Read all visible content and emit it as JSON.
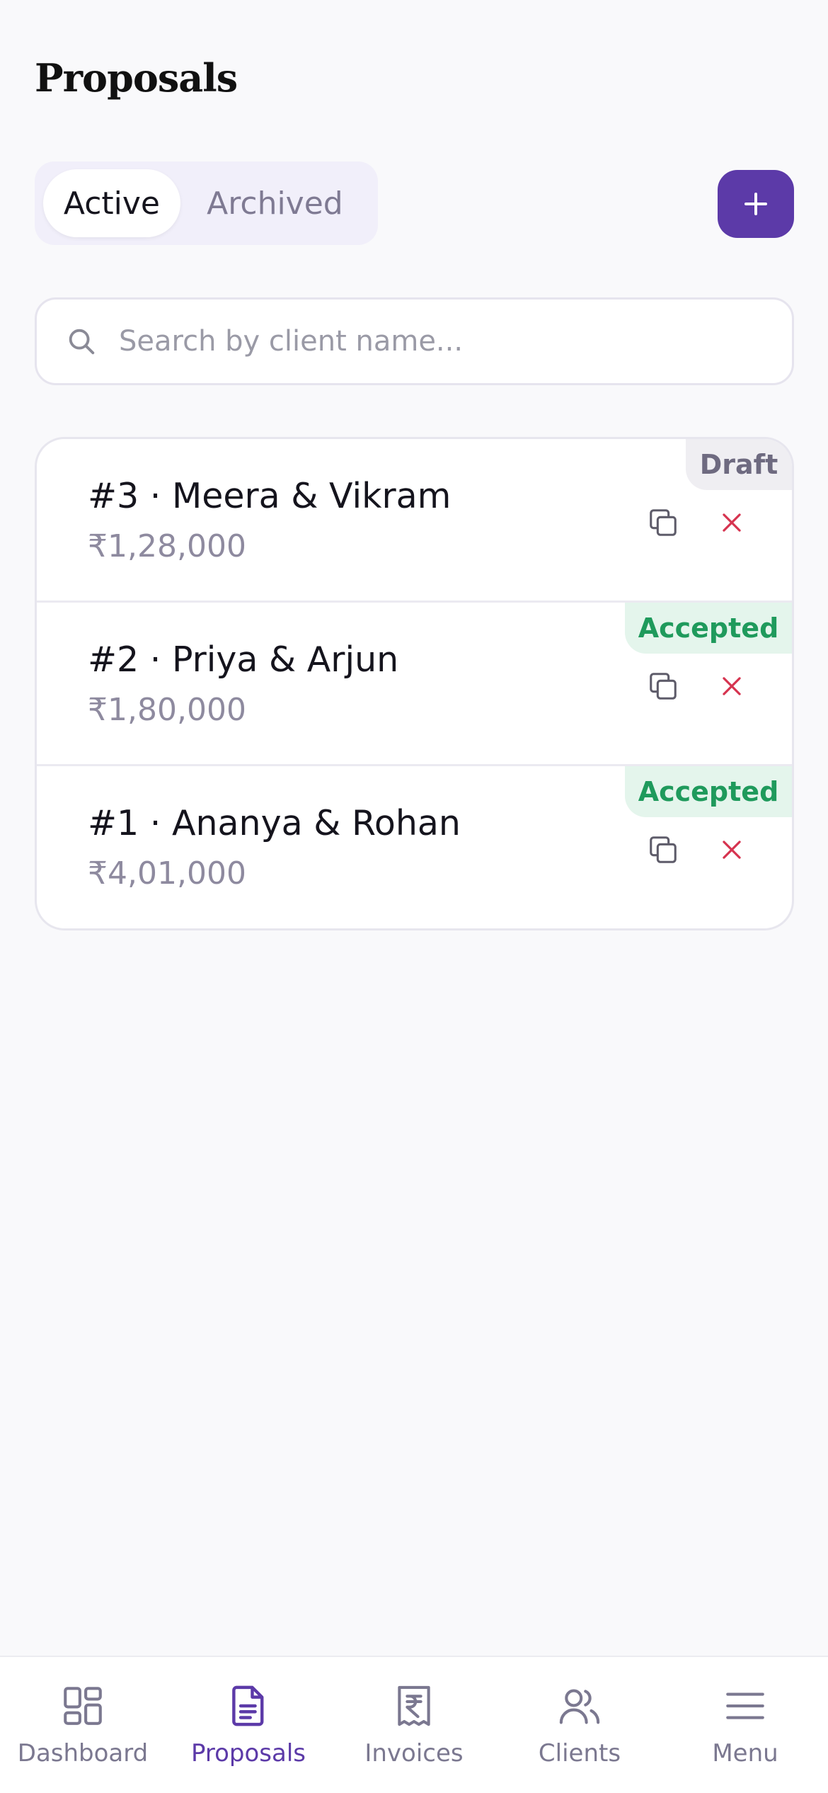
{
  "header": {
    "title": "Proposals"
  },
  "tabs": [
    {
      "label": "Active",
      "active": true
    },
    {
      "label": "Archived",
      "active": false
    }
  ],
  "add_button": {
    "icon": "plus-icon"
  },
  "search": {
    "placeholder": "Search by client name...",
    "value": ""
  },
  "proposals": [
    {
      "title": "#3 · Meera & Vikram",
      "amount": "₹1,28,000",
      "status": "Draft"
    },
    {
      "title": "#2 · Priya & Arjun",
      "amount": "₹1,80,000",
      "status": "Accepted"
    },
    {
      "title": "#1 · Ananya & Rohan",
      "amount": "₹4,01,000",
      "status": "Accepted"
    }
  ],
  "nav": [
    {
      "label": "Dashboard",
      "icon": "dashboard-icon",
      "active": false
    },
    {
      "label": "Proposals",
      "icon": "document-icon",
      "active": true
    },
    {
      "label": "Invoices",
      "icon": "invoice-icon",
      "active": false
    },
    {
      "label": "Clients",
      "icon": "users-icon",
      "active": false
    },
    {
      "label": "Menu",
      "icon": "menu-icon",
      "active": false
    }
  ],
  "colors": {
    "accent": "#5c3aa8",
    "accepted": "#1f9a5c",
    "danger": "#d6334f"
  }
}
